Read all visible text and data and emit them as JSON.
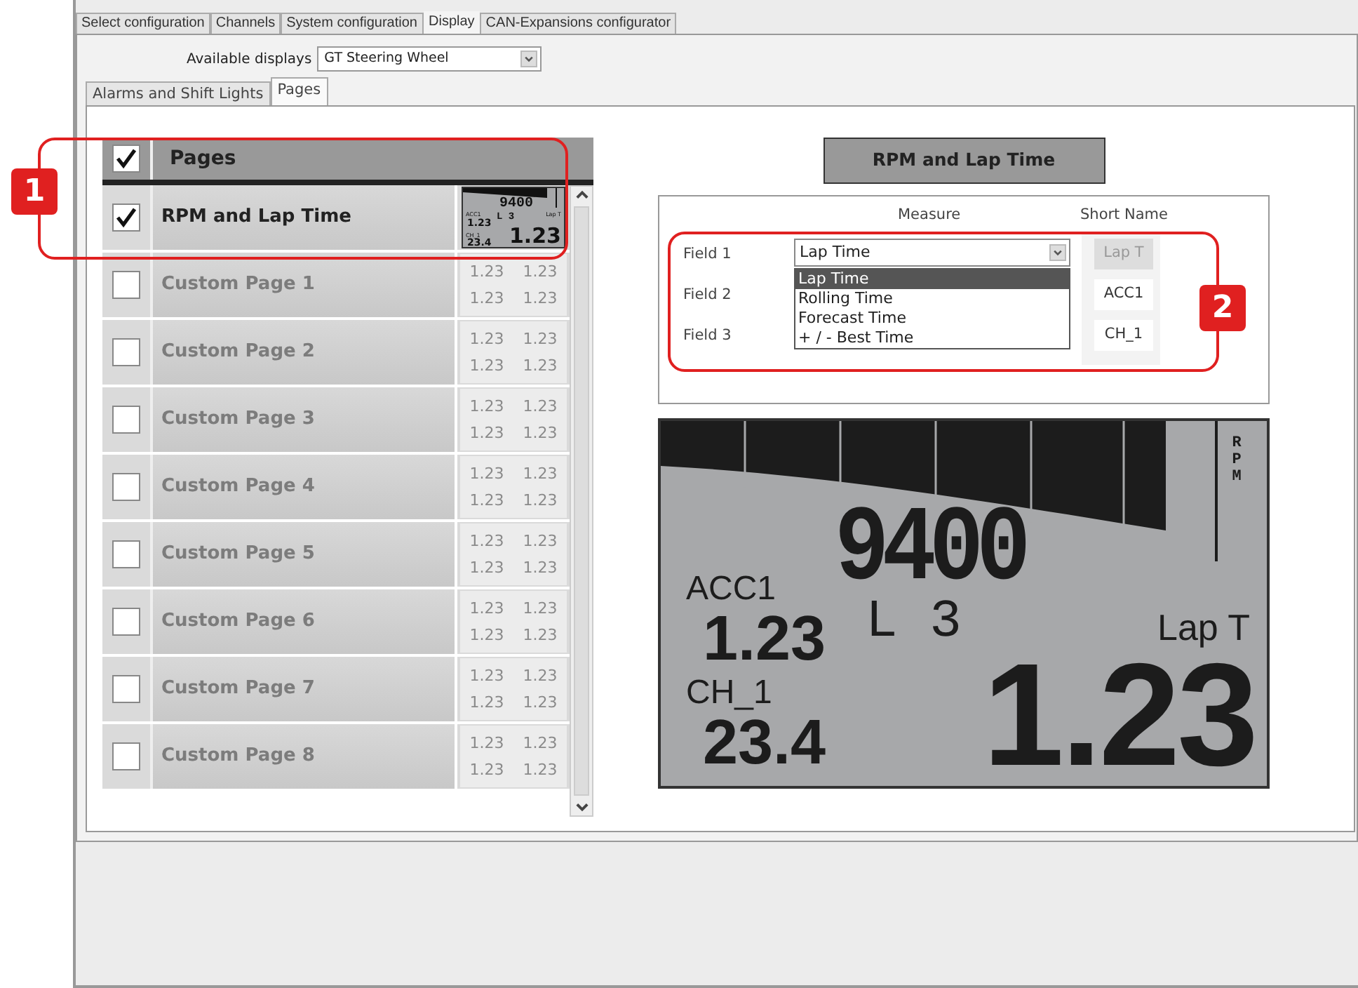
{
  "top_tabs": [
    {
      "label": "Select configuration",
      "selected": false
    },
    {
      "label": "Channels",
      "selected": false
    },
    {
      "label": "System configuration",
      "selected": false
    },
    {
      "label": "Display",
      "selected": true
    },
    {
      "label": "CAN-Expansions configurator",
      "selected": false
    }
  ],
  "available_displays": {
    "label": "Available displays",
    "value": "GT Steering Wheel"
  },
  "sub_tabs": [
    {
      "label": "Alarms and Shift Lights",
      "selected": false
    },
    {
      "label": "Pages",
      "selected": true
    }
  ],
  "pages_header": {
    "label": "Pages",
    "checked": true
  },
  "pages": [
    {
      "name": "RPM and Lap Time",
      "checked": true,
      "kind": "preview",
      "preview": {
        "rpm": "9400",
        "gear": "L 3",
        "small_fields": [
          {
            "name": "ACC1",
            "value": "1.23"
          },
          {
            "name": "CH_1",
            "value": "23.4"
          }
        ],
        "main_field": {
          "name": "Lap T",
          "value": "1.23"
        }
      }
    },
    {
      "name": "Custom Page 1",
      "checked": false,
      "kind": "blank",
      "thumb_values": [
        "1.23",
        "1.23",
        "1.23",
        "1.23"
      ]
    },
    {
      "name": "Custom Page 2",
      "checked": false,
      "kind": "blank",
      "thumb_values": [
        "1.23",
        "1.23",
        "1.23",
        "1.23"
      ]
    },
    {
      "name": "Custom Page 3",
      "checked": false,
      "kind": "blank",
      "thumb_values": [
        "1.23",
        "1.23",
        "1.23",
        "1.23"
      ]
    },
    {
      "name": "Custom Page 4",
      "checked": false,
      "kind": "blank",
      "thumb_values": [
        "1.23",
        "1.23",
        "1.23",
        "1.23"
      ]
    },
    {
      "name": "Custom Page 5",
      "checked": false,
      "kind": "blank",
      "thumb_values": [
        "1.23",
        "1.23",
        "1.23",
        "1.23"
      ]
    },
    {
      "name": "Custom Page 6",
      "checked": false,
      "kind": "blank",
      "thumb_values": [
        "1.23",
        "1.23",
        "1.23",
        "1.23"
      ]
    },
    {
      "name": "Custom Page 7",
      "checked": false,
      "kind": "blank",
      "thumb_values": [
        "1.23",
        "1.23",
        "1.23",
        "1.23"
      ]
    },
    {
      "name": "Custom Page 8",
      "checked": false,
      "kind": "blank",
      "thumb_values": [
        "1.23",
        "1.23",
        "1.23",
        "1.23"
      ]
    }
  ],
  "page_title": "RPM and Lap Time",
  "fields": {
    "columns": [
      "Measure",
      "Short Name"
    ],
    "rows": [
      {
        "label": "Field 1",
        "measure": "Lap Time",
        "short_name": "Lap T",
        "disabled": true
      },
      {
        "label": "Field 2",
        "short_name": "ACC1",
        "disabled": false
      },
      {
        "label": "Field 3",
        "short_name": "CH_1",
        "disabled": false
      }
    ],
    "dropdown_options": [
      {
        "label": "Lap Time",
        "selected": true
      },
      {
        "label": "Rolling Time",
        "selected": false
      },
      {
        "label": "Forecast Time",
        "selected": false
      },
      {
        "label": "+ / - Best Time",
        "selected": false
      }
    ]
  },
  "display": {
    "rpm": "9400",
    "rpm_unit": "RPM",
    "gear": "L 3",
    "small_fields": [
      {
        "name": "ACC1",
        "value": "1.23"
      },
      {
        "name": "CH_1",
        "value": "23.4"
      }
    ],
    "main_field": {
      "name": "Lap T",
      "value": "1.23"
    }
  },
  "callouts": [
    {
      "number": "1"
    },
    {
      "number": "2"
    }
  ]
}
